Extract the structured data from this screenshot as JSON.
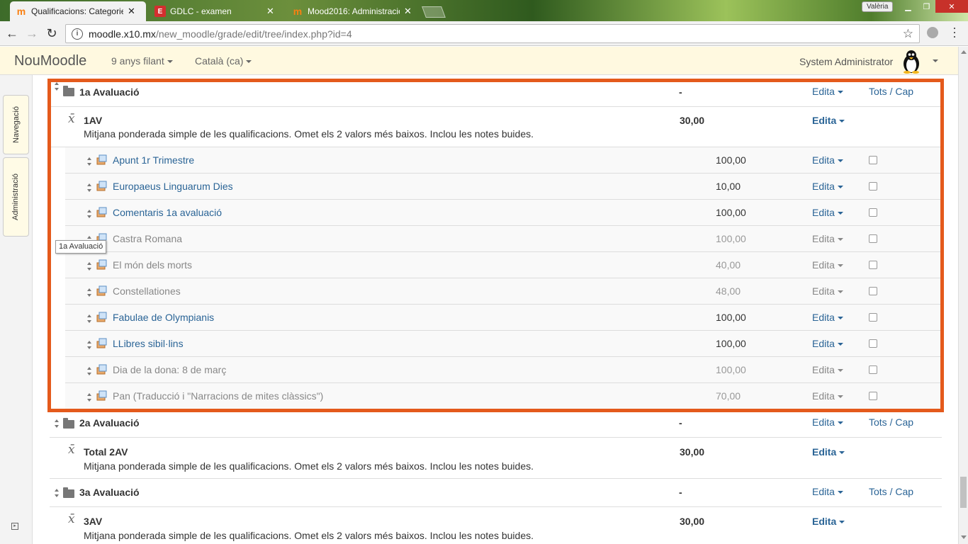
{
  "browser": {
    "tabs": [
      {
        "title": "Qualificacions: Categorie",
        "active": true
      },
      {
        "title": "GDLC - examen",
        "active": false
      },
      {
        "title": "Mood2016: Administració",
        "active": false
      }
    ],
    "user_chip": "Valèria",
    "url_host": "moodle.x10.mx",
    "url_path": "/new_moodle/grade/edit/tree/index.php?id=4"
  },
  "navbar": {
    "brand": "NouMoodle",
    "menu1": "9 anys filant",
    "menu2": "Català (ca)",
    "user": "System Administrator"
  },
  "dock": {
    "nav": "Navegació",
    "admin": "Administració"
  },
  "tooltip": "1a Avaluació",
  "common": {
    "edit": "Edita",
    "tots_cap": "Tots / Cap",
    "total_desc": "Mitjana ponderada simple de les qualificacions. Omet els 2 valors més baixos. Inclou les notes buides."
  },
  "categories": [
    {
      "name": "1a Avaluació",
      "value": "-",
      "total_name": "1AV",
      "total_value": "30,00"
    },
    {
      "name": "2a Avaluació",
      "value": "-",
      "total_name": "Total 2AV",
      "total_value": "30,00"
    },
    {
      "name": "3a Avaluació",
      "value": "-",
      "total_name": "3AV",
      "total_value": "30,00"
    }
  ],
  "items": [
    {
      "name": "Apunt 1r Trimestre",
      "value": "100,00",
      "hidden": false
    },
    {
      "name": "Europaeus Linguarum Dies",
      "value": "10,00",
      "hidden": false
    },
    {
      "name": "Comentaris 1a avaluació",
      "value": "100,00",
      "hidden": false
    },
    {
      "name": "Castra Romana",
      "value": "100,00",
      "hidden": true
    },
    {
      "name": "El món dels morts",
      "value": "40,00",
      "hidden": true
    },
    {
      "name": "Constellationes",
      "value": "48,00",
      "hidden": true
    },
    {
      "name": "Fabulae de Olympianis",
      "value": "100,00",
      "hidden": false
    },
    {
      "name": "LLibres sibil·lins",
      "value": "100,00",
      "hidden": false
    },
    {
      "name": "Dia de la dona: 8 de març",
      "value": "100,00",
      "hidden": true
    },
    {
      "name": "Pan (Traducció i \"Narracions de mites clàssics\")",
      "value": "70,00",
      "hidden": true
    }
  ],
  "colors": {
    "link": "#2a6496",
    "highlight": "#e45a1c",
    "navbar_bg": "#fff9e0"
  }
}
